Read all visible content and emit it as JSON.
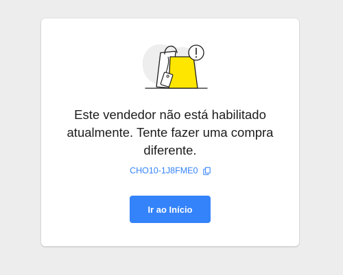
{
  "error": {
    "message": "Este vendedor não está habilitado atualmente. Tente fazer uma compra diferente.",
    "code": "CHO10-1J8FME0",
    "copy_icon": "copy-icon",
    "illustration_icon": "shopping-bag-warning-icon"
  },
  "actions": {
    "home_label": "Ir ao Início"
  },
  "colors": {
    "accent": "#3483fa",
    "bag_yellow": "#ffe600",
    "background": "#ededed"
  }
}
